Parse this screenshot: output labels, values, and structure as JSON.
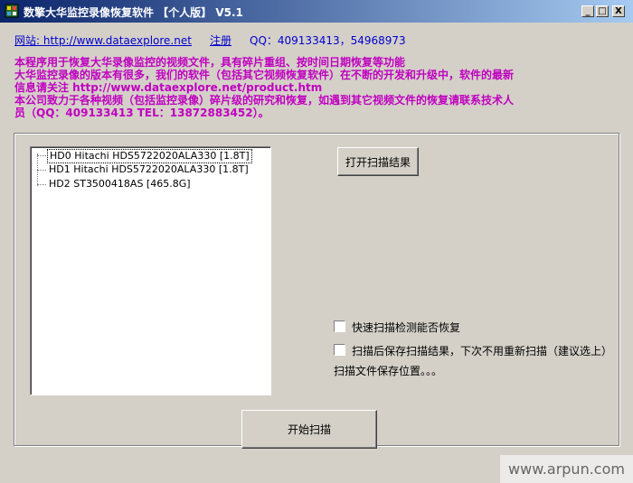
{
  "window": {
    "title": "数擎大华监控录像恢复软件 【个人版】  V5.1",
    "controls": {
      "minimize": "_",
      "maximize": "□",
      "close": "X"
    }
  },
  "header": {
    "website_link": "网站: http://www.dataexplore.net",
    "register_link": "注册",
    "qq_info": "QQ：409133413，54968973"
  },
  "notice": {
    "lines": [
      "本程序用于恢复大华录像监控的视频文件，具有碎片重组、按时间日期恢复等功能",
      "大华监控录像的版本有很多，我们的软件（包括其它视频恢复软件）在不断的开发和升级中，软件的最新",
      "信息请关注 http://www.dataexplore.net/product.htm",
      "本公司致力于各种视频（包括监控录像）碎片级的研究和恢复，如遇到其它视频文件的恢复请联系技术人",
      "员（QQ：409133413 TEL：13872883452）。"
    ]
  },
  "disk_tree": {
    "items": [
      "HD0  Hitachi HDS5722020ALA330 [1.8T]",
      "HD1  Hitachi HDS5722020ALA330 [1.8T]",
      "HD2  ST3500418AS [465.8G]"
    ],
    "selected_index": 0
  },
  "buttons": {
    "open_results": "打开扫描结果",
    "start_scan": "开始扫描"
  },
  "options": {
    "quick_scan": {
      "label": "快速扫描检测能否恢复",
      "checked": false
    },
    "save_results": {
      "label": "扫描后保存扫描结果，下次不用重新扫描（建议选上）",
      "checked": false
    },
    "save_location": "扫描文件保存位置。。。"
  },
  "watermark": "www.arpun.com",
  "colors": {
    "title_start": "#0a246a",
    "title_end": "#a6caf0",
    "link": "#0000cc",
    "notice": "#c000c0",
    "face": "#d4d0c8"
  },
  "icons": {
    "app": "app-icon"
  }
}
